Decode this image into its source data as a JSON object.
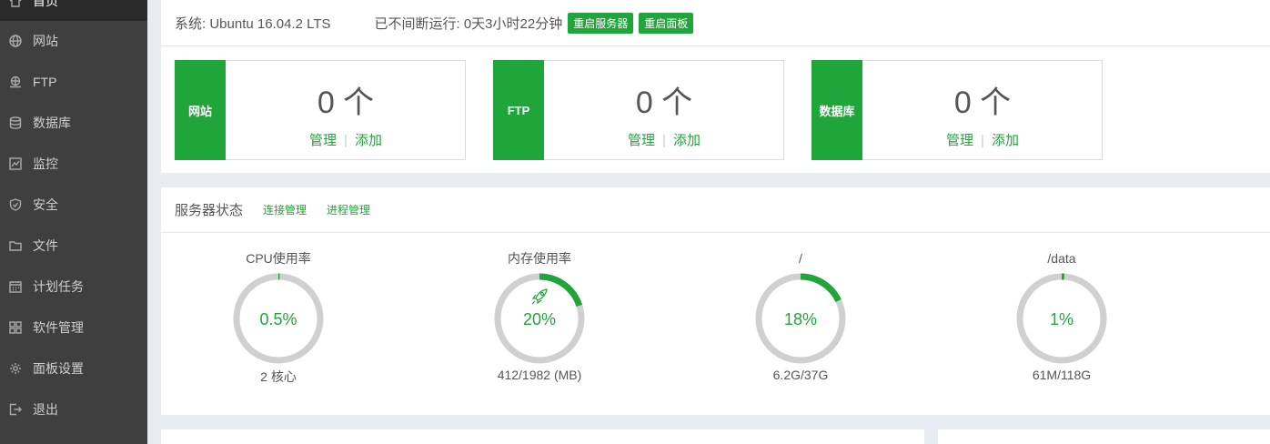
{
  "sidebar": {
    "items": [
      {
        "label": "首页",
        "icon": "home-icon",
        "active": true
      },
      {
        "label": "网站",
        "icon": "globe-icon"
      },
      {
        "label": "FTP",
        "icon": "ftp-icon"
      },
      {
        "label": "数据库",
        "icon": "database-icon"
      },
      {
        "label": "监控",
        "icon": "monitor-icon"
      },
      {
        "label": "安全",
        "icon": "shield-icon"
      },
      {
        "label": "文件",
        "icon": "folder-icon"
      },
      {
        "label": "计划任务",
        "icon": "calendar-icon"
      },
      {
        "label": "软件管理",
        "icon": "grid-icon"
      },
      {
        "label": "面板设置",
        "icon": "gear-icon"
      },
      {
        "label": "退出",
        "icon": "logout-icon"
      }
    ]
  },
  "system": {
    "os": "系统: Ubuntu 16.04.2 LTS",
    "uptime": "已不间断运行: 0天3小时22分钟",
    "restart_server": "重启服务器",
    "restart_panel": "重启面板"
  },
  "cards": [
    {
      "tag": "网站",
      "count": "0 个",
      "manage": "管理",
      "add": "添加"
    },
    {
      "tag": "FTP",
      "count": "0 个",
      "manage": "管理",
      "add": "添加"
    },
    {
      "tag": "数据库",
      "count": "0 个",
      "manage": "管理",
      "add": "添加"
    }
  ],
  "status": {
    "title": "服务器状态",
    "conn_manage": "连接管理",
    "proc_manage": "进程管理",
    "gauges": [
      {
        "label": "CPU使用率",
        "percent_text": "0.5%",
        "value": 0.5,
        "sub": "2 核心"
      },
      {
        "label": "内存使用率",
        "percent_text": "20%",
        "value": 20,
        "sub": "412/1982 (MB)",
        "icon": "rocket-icon"
      },
      {
        "label": "/",
        "percent_text": "18%",
        "value": 18,
        "sub": "6.2G/37G"
      },
      {
        "label": "/data",
        "percent_text": "1%",
        "value": 1,
        "sub": "61M/118G"
      }
    ]
  },
  "colors": {
    "accent": "#20a53a",
    "track": "#d0d0d0",
    "sidebar": "#3f3f3f"
  }
}
